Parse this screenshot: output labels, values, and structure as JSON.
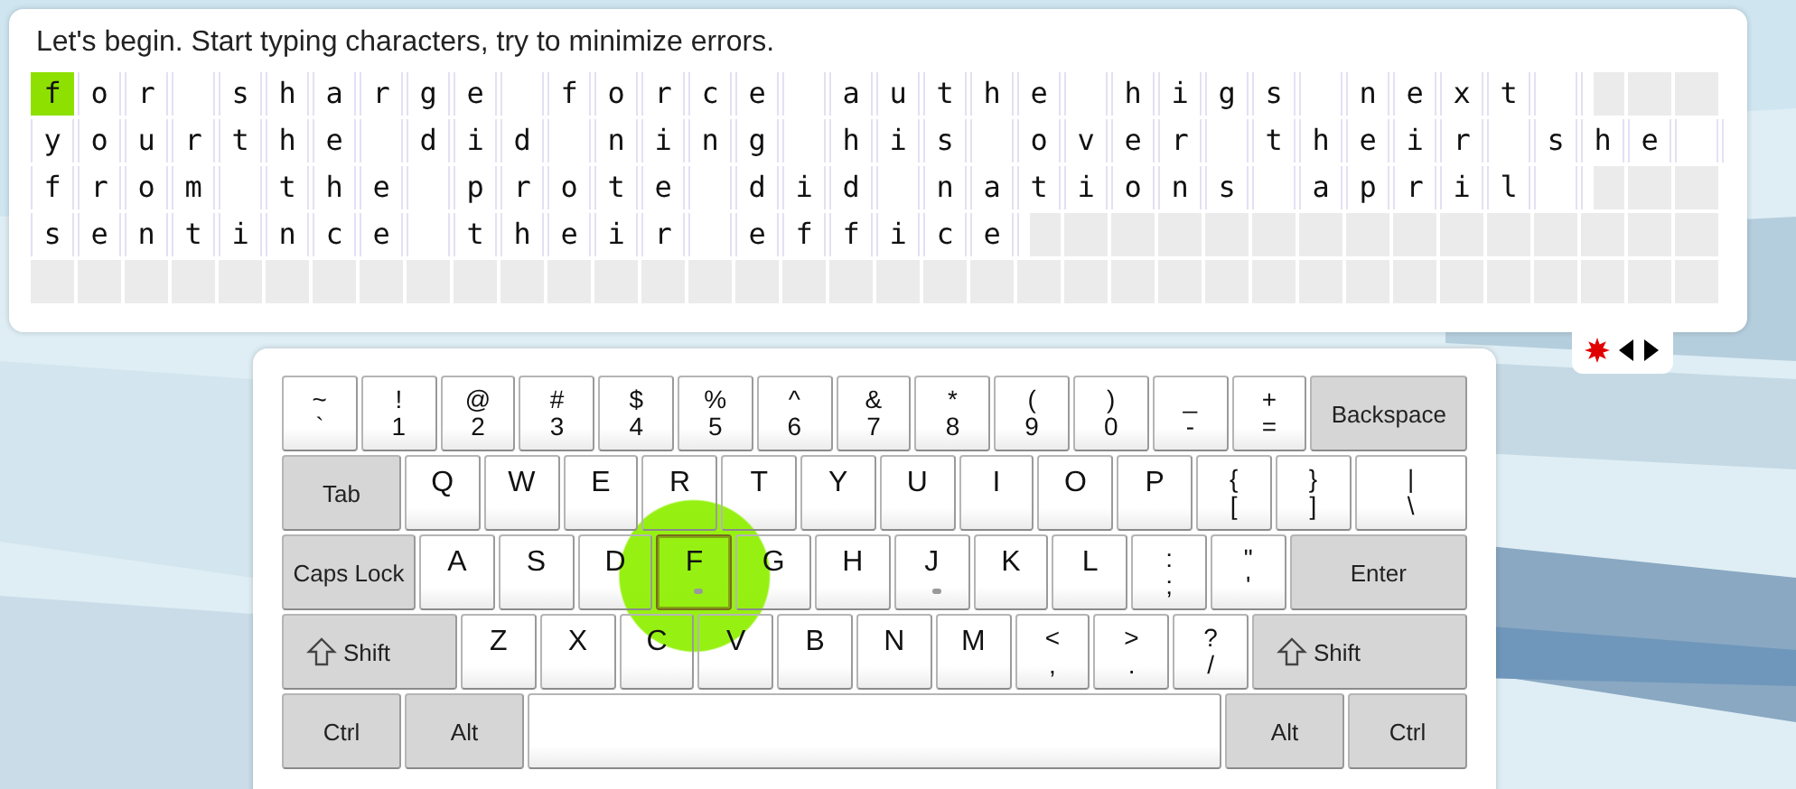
{
  "instruction": "Let's begin. Start typing characters, try to minimize errors.",
  "lines": [
    {
      "text": "for sharge force authe higs next ",
      "cursor_at_start": true
    },
    {
      "text": "yourthe did ning his over their she ",
      "cursor_at_start": false
    },
    {
      "text": "from the prote did nations april ",
      "cursor_at_start": false
    },
    {
      "text": "sentince their effice",
      "cursor_at_start": false
    }
  ],
  "keyboard": {
    "rows": [
      {
        "keys": [
          {
            "kind": "char",
            "upper": "~",
            "lower": "`",
            "target": false,
            "bump": false
          },
          {
            "kind": "char",
            "upper": "!",
            "lower": "1",
            "target": false,
            "bump": false
          },
          {
            "kind": "char",
            "upper": "@",
            "lower": "2",
            "target": false,
            "bump": false
          },
          {
            "kind": "char",
            "upper": "#",
            "lower": "3",
            "target": false,
            "bump": false
          },
          {
            "kind": "char",
            "upper": "$",
            "lower": "4",
            "target": false,
            "bump": false
          },
          {
            "kind": "char",
            "upper": "%",
            "lower": "5",
            "target": false,
            "bump": false
          },
          {
            "kind": "char",
            "upper": "^",
            "lower": "6",
            "target": false,
            "bump": false
          },
          {
            "kind": "char",
            "upper": "&",
            "lower": "7",
            "target": false,
            "bump": false
          },
          {
            "kind": "char",
            "upper": "*",
            "lower": "8",
            "target": false,
            "bump": false
          },
          {
            "kind": "char",
            "upper": "(",
            "lower": "9",
            "target": false,
            "bump": false
          },
          {
            "kind": "char",
            "upper": ")",
            "lower": "0",
            "target": false,
            "bump": false
          },
          {
            "kind": "char",
            "upper": "_",
            "lower": "-",
            "target": false,
            "bump": false
          },
          {
            "kind": "char",
            "upper": "+",
            "lower": "=",
            "target": false,
            "bump": false
          },
          {
            "kind": "mod",
            "label": "Backspace",
            "target": false,
            "bump": false
          }
        ]
      },
      {
        "keys": [
          {
            "kind": "mod",
            "label": "Tab",
            "target": false,
            "bump": false
          },
          {
            "kind": "letter",
            "label": "Q",
            "target": false,
            "bump": false
          },
          {
            "kind": "letter",
            "label": "W",
            "target": false,
            "bump": false
          },
          {
            "kind": "letter",
            "label": "E",
            "target": false,
            "bump": false
          },
          {
            "kind": "letter",
            "label": "R",
            "target": false,
            "bump": false
          },
          {
            "kind": "letter",
            "label": "T",
            "target": false,
            "bump": false
          },
          {
            "kind": "letter",
            "label": "Y",
            "target": false,
            "bump": false
          },
          {
            "kind": "letter",
            "label": "U",
            "target": false,
            "bump": false
          },
          {
            "kind": "letter",
            "label": "I",
            "target": false,
            "bump": false
          },
          {
            "kind": "letter",
            "label": "O",
            "target": false,
            "bump": false
          },
          {
            "kind": "letter",
            "label": "P",
            "target": false,
            "bump": false
          },
          {
            "kind": "char",
            "upper": "{",
            "lower": "[",
            "target": false,
            "bump": false
          },
          {
            "kind": "char",
            "upper": "}",
            "lower": "]",
            "target": false,
            "bump": false
          },
          {
            "kind": "char",
            "upper": "|",
            "lower": "\\",
            "target": false,
            "bump": false
          }
        ]
      },
      {
        "keys": [
          {
            "kind": "mod",
            "label": "Caps Lock",
            "target": false,
            "bump": false
          },
          {
            "kind": "letter",
            "label": "A",
            "target": false,
            "bump": false
          },
          {
            "kind": "letter",
            "label": "S",
            "target": false,
            "bump": false
          },
          {
            "kind": "letter",
            "label": "D",
            "target": false,
            "bump": false
          },
          {
            "kind": "letter",
            "label": "F",
            "target": true,
            "bump": true
          },
          {
            "kind": "letter",
            "label": "G",
            "target": false,
            "bump": false
          },
          {
            "kind": "letter",
            "label": "H",
            "target": false,
            "bump": false
          },
          {
            "kind": "letter",
            "label": "J",
            "target": false,
            "bump": true
          },
          {
            "kind": "letter",
            "label": "K",
            "target": false,
            "bump": false
          },
          {
            "kind": "letter",
            "label": "L",
            "target": false,
            "bump": false
          },
          {
            "kind": "char",
            "upper": ":",
            "lower": ";",
            "target": false,
            "bump": false
          },
          {
            "kind": "char",
            "upper": "\"",
            "lower": "'",
            "target": false,
            "bump": false
          },
          {
            "kind": "mod",
            "label": "Enter",
            "target": false,
            "bump": false
          }
        ]
      },
      {
        "keys": [
          {
            "kind": "shift",
            "label": "Shift",
            "target": false,
            "bump": false
          },
          {
            "kind": "letter",
            "label": "Z",
            "target": false,
            "bump": false
          },
          {
            "kind": "letter",
            "label": "X",
            "target": false,
            "bump": false
          },
          {
            "kind": "letter",
            "label": "C",
            "target": false,
            "bump": false
          },
          {
            "kind": "letter",
            "label": "V",
            "target": false,
            "bump": false
          },
          {
            "kind": "letter",
            "label": "B",
            "target": false,
            "bump": false
          },
          {
            "kind": "letter",
            "label": "N",
            "target": false,
            "bump": false
          },
          {
            "kind": "letter",
            "label": "M",
            "target": false,
            "bump": false
          },
          {
            "kind": "char",
            "upper": "<",
            "lower": ",",
            "target": false,
            "bump": false
          },
          {
            "kind": "char",
            "upper": ">",
            "lower": ".",
            "target": false,
            "bump": false
          },
          {
            "kind": "char",
            "upper": "?",
            "lower": "/",
            "target": false,
            "bump": false
          },
          {
            "kind": "shift",
            "label": "Shift",
            "target": false,
            "bump": false
          }
        ]
      },
      {
        "keys": [
          {
            "kind": "mod",
            "label": "Ctrl",
            "target": false,
            "bump": false
          },
          {
            "kind": "mod",
            "label": "Alt",
            "target": false,
            "bump": false
          },
          {
            "kind": "space",
            "target": false,
            "bump": false
          },
          {
            "kind": "mod",
            "label": "Alt",
            "target": false,
            "bump": false
          },
          {
            "kind": "mod",
            "label": "Ctrl",
            "target": false,
            "bump": false
          }
        ]
      }
    ]
  }
}
